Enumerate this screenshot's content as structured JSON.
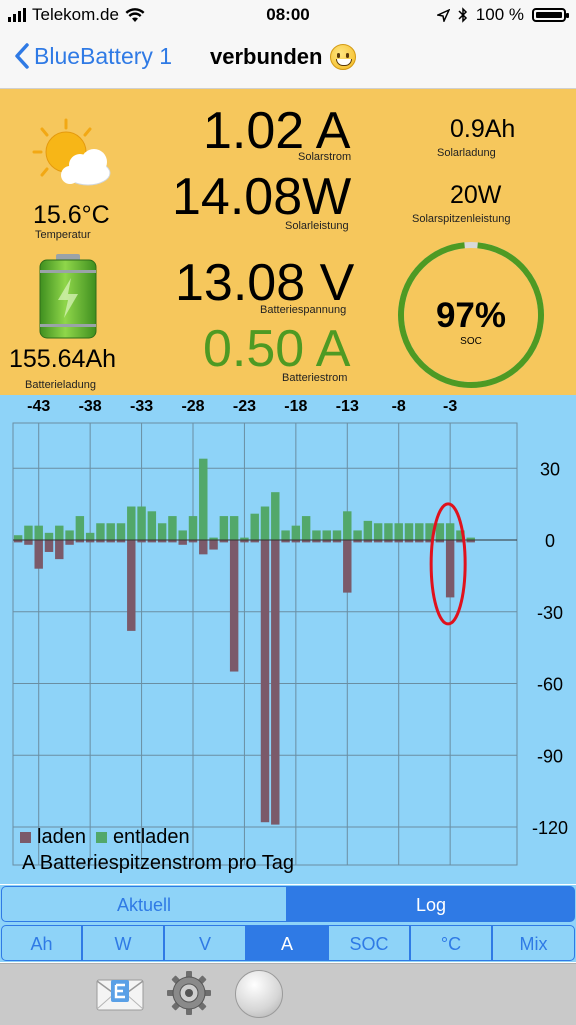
{
  "status_bar": {
    "carrier": "Telekom.de",
    "time": "08:00",
    "battery_pct": "100 %"
  },
  "nav": {
    "back_label": "BlueBattery 1",
    "connection_status": "verbunden"
  },
  "readings": {
    "temperature": {
      "value": "15.6°C",
      "label": "Temperatur"
    },
    "solar_current": {
      "value": "1.02 A",
      "label": "Solarstrom"
    },
    "solar_power": {
      "value": "14.08W",
      "label": "Solarleistung"
    },
    "solar_charge": {
      "value": "0.9Ah",
      "label": "Solarladung"
    },
    "solar_peak_power": {
      "value": "20W",
      "label": "Solarspitzenleistung"
    },
    "battery_voltage": {
      "value": "13.08 V",
      "label": "Batteriespannung"
    },
    "battery_current": {
      "value": "0.50 A",
      "label": "Batteriestrom"
    },
    "battery_charge": {
      "value": "155.64Ah",
      "label": "Batterieladung"
    },
    "soc": {
      "value": "97%",
      "label": "SOC",
      "fraction": 0.97
    }
  },
  "chart_data": {
    "type": "bar",
    "title": "A Batteriespitzenstrom pro Tag",
    "x_ticks": [
      "-43",
      "-38",
      "-33",
      "-28",
      "-23",
      "-18",
      "-13",
      "-8",
      "-3"
    ],
    "y_ticks": [
      "30",
      "0",
      "-30",
      "-60",
      "-90",
      "-120"
    ],
    "ylim": [
      -120,
      30
    ],
    "xlim": [
      -45,
      3
    ],
    "legend": [
      "laden",
      "entladen"
    ],
    "legend_position": "bottom-left",
    "grid": true,
    "x": [
      -45,
      -44,
      -43,
      -42,
      -41,
      -40,
      -39,
      -38,
      -37,
      -36,
      -35,
      -34,
      -33,
      -32,
      -31,
      -30,
      -29,
      -28,
      -27,
      -26,
      -25,
      -24,
      -23,
      -22,
      -21,
      -20,
      -19,
      -18,
      -17,
      -16,
      -15,
      -14,
      -13,
      -12,
      -11,
      -10,
      -9,
      -8,
      -7,
      -6,
      -5,
      -4,
      -3,
      -2,
      -1
    ],
    "series": [
      {
        "name": "laden",
        "color": "#7b5a6a",
        "values": [
          -1,
          -2,
          -12,
          -5,
          -8,
          -2,
          -1,
          -1,
          -1,
          -1,
          -1,
          -38,
          -1,
          -1,
          -1,
          -1,
          -2,
          -1,
          -6,
          -4,
          -1,
          -55,
          -1,
          -1,
          -118,
          -119,
          -1,
          -1,
          -1,
          -1,
          -1,
          -1,
          -22,
          -1,
          -1,
          -1,
          -1,
          -1,
          -1,
          -1,
          -1,
          -1,
          -24,
          -1,
          -1
        ]
      },
      {
        "name": "entladen",
        "color": "#52a86a",
        "values": [
          2,
          6,
          6,
          3,
          6,
          4,
          10,
          3,
          7,
          7,
          7,
          14,
          14,
          12,
          7,
          10,
          4,
          10,
          34,
          1,
          10,
          10,
          1,
          11,
          14,
          20,
          4,
          6,
          10,
          4,
          4,
          4,
          12,
          4,
          8,
          7,
          7,
          7,
          7,
          7,
          7,
          7,
          7,
          4,
          1
        ]
      }
    ]
  },
  "tabs_mode": [
    {
      "label": "Aktuell",
      "active": false
    },
    {
      "label": "Log",
      "active": true
    }
  ],
  "tabs_unit": [
    {
      "label": "Ah",
      "active": false
    },
    {
      "label": "W",
      "active": false
    },
    {
      "label": "V",
      "active": false
    },
    {
      "label": "A",
      "active": true
    },
    {
      "label": "SOC",
      "active": false
    },
    {
      "label": "°C",
      "active": false
    },
    {
      "label": "Mix",
      "active": false
    }
  ],
  "colors": {
    "accent": "#2f7ae5",
    "panel": "#f6c75c",
    "chart_bg": "#8ed3f8",
    "soc_ring": "#4e9a23"
  },
  "icons": [
    "weather-sun-cloud-icon",
    "battery-charging-icon",
    "email-icon",
    "settings-gear-icon",
    "round-button-icon"
  ]
}
